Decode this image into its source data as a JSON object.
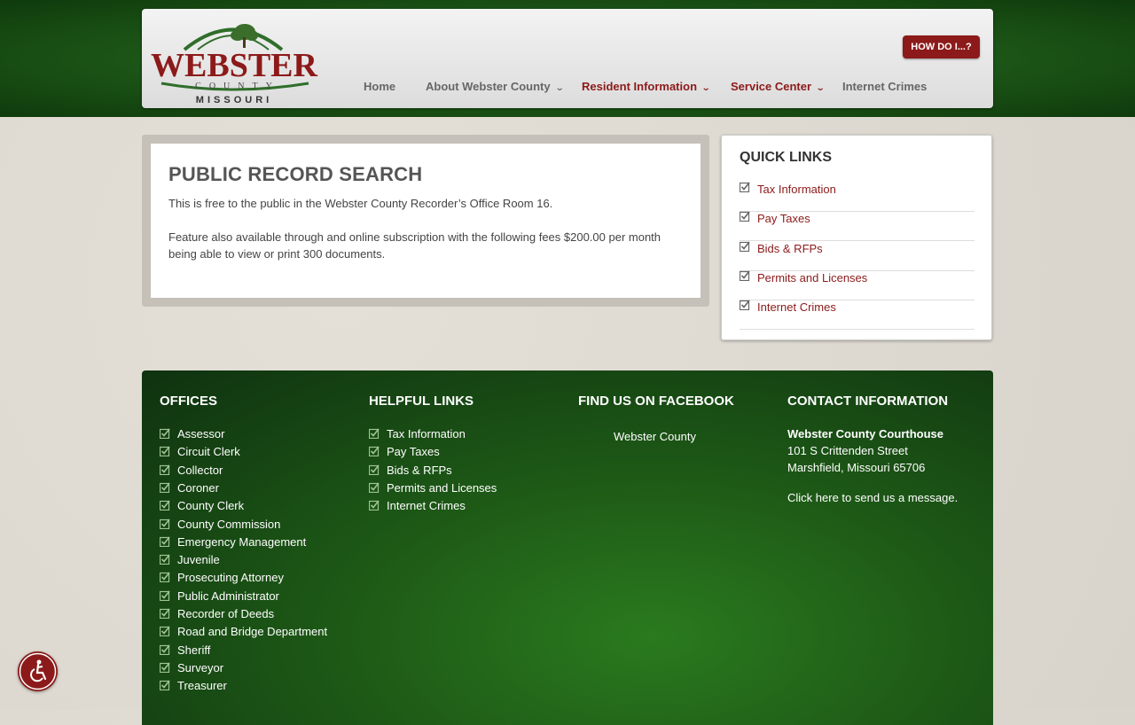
{
  "logo": {
    "line1": "WEBSTER",
    "line2": "COUNTY",
    "line3": "MISSOURI"
  },
  "header": {
    "how_do_i": "HOW DO I...?"
  },
  "nav": {
    "items": [
      {
        "label": "Home"
      },
      {
        "label": "About Webster County"
      },
      {
        "label": "Resident Information"
      },
      {
        "label": "Service Center"
      },
      {
        "label": "Internet Crimes"
      }
    ]
  },
  "main": {
    "title": "PUBLIC RECORD SEARCH",
    "para1": "This is free to the public in the Webster County Recorder’s Office Room 16.",
    "para2": "Feature also available through and online subscription with the following fees $200.00 per month being able to view or print 300 documents."
  },
  "quick_links": {
    "title": "QUICK LINKS",
    "items": [
      "Tax Information",
      "Pay Taxes",
      "Bids & RFPs",
      "Permits and Licenses",
      "Internet Crimes"
    ]
  },
  "footer": {
    "offices": {
      "title": "OFFICES",
      "items": [
        "Assessor",
        "Circuit Clerk",
        "Collector",
        "Coroner",
        "County Clerk",
        "County Commission",
        "Emergency Management",
        "Juvenile",
        "Prosecuting Attorney",
        "Public Administrator",
        "Recorder of Deeds",
        "Road and Bridge Department",
        "Sheriff",
        "Surveyor",
        "Treasurer"
      ]
    },
    "helpful": {
      "title": "HELPFUL LINKS",
      "items": [
        "Tax Information",
        "Pay Taxes",
        "Bids & RFPs",
        "Permits and Licenses",
        "Internet Crimes"
      ]
    },
    "facebook": {
      "title": "FIND US ON FACEBOOK",
      "link": "Webster County"
    },
    "contact": {
      "title": "CONTACT INFORMATION",
      "name": "Webster County Courthouse",
      "street": "101 S Crittenden Street",
      "city": "Marshfield, Missouri 65706",
      "message": "Click here to send us a message."
    }
  },
  "colors": {
    "brand_red": "#8c1a1a",
    "brand_green": "#1e5a18"
  },
  "icons": {
    "checkbox": "check-square-icon",
    "accessibility": "accessibility-icon"
  }
}
